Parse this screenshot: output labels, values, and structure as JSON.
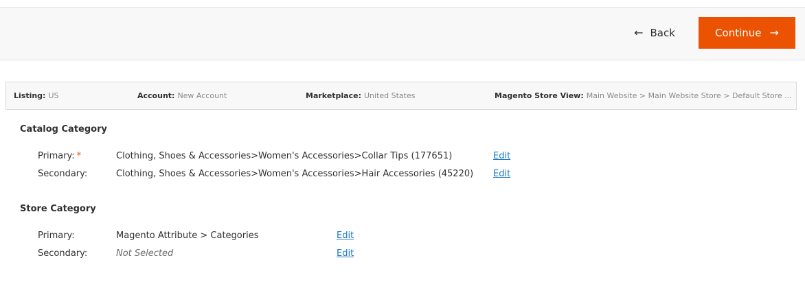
{
  "toolbar": {
    "back_label": "Back",
    "back_icon": "arrow-left-icon",
    "continue_label": "Continue",
    "continue_icon": "arrow-right-icon",
    "accent_color": "#eb5202"
  },
  "info_bar": {
    "listing": {
      "label": "Listing:",
      "value": "US"
    },
    "account": {
      "label": "Account:",
      "value": "New Account"
    },
    "marketplace": {
      "label": "Marketplace:",
      "value": "United States"
    },
    "store_view": {
      "label": "Magento Store View:",
      "value": "Main Website > Main Website Store > Default Store ..."
    }
  },
  "catalog_category": {
    "title": "Catalog Category",
    "primary": {
      "label": "Primary:",
      "required_mark": "*",
      "value": "Clothing, Shoes & Accessories>Women's Accessories>Collar Tips (177651)",
      "edit": "Edit"
    },
    "secondary": {
      "label": "Secondary:",
      "value": "Clothing, Shoes & Accessories>Women's Accessories>Hair Accessories (45220)",
      "edit": "Edit"
    }
  },
  "store_category": {
    "title": "Store Category",
    "primary": {
      "label": "Primary:",
      "value": "Magento Attribute > Categories",
      "edit": "Edit"
    },
    "secondary": {
      "label": "Secondary:",
      "value": "Not Selected",
      "edit": "Edit"
    }
  }
}
